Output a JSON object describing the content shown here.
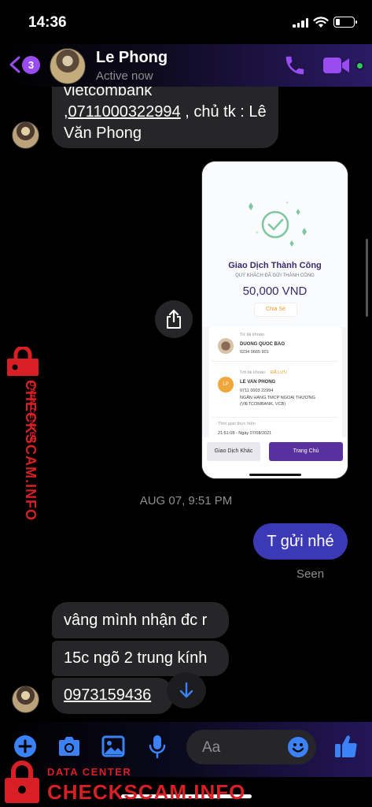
{
  "status_bar": {
    "time": "14:36",
    "battery_level": 0.25
  },
  "header": {
    "unread_count": "3",
    "contact_name": "Le Phong",
    "contact_status": "Active now",
    "icons": [
      "back-chevron-icon",
      "phone-icon",
      "video-icon"
    ],
    "accent_color": "#9a4cf1"
  },
  "messages": {
    "received_1": {
      "line1": "vietcombank",
      "account": ",0711000322994",
      "rest": " , chủ tk : Lê",
      "line3": "Văn Phong"
    },
    "screenshot": {
      "title": "Giao Dịch Thành Công",
      "subtitle": "QUÝ KHÁCH ĐÃ GỬI THÀNH CÔNG",
      "amount": "50,000 VND",
      "share_label": "Chia Sẻ",
      "from_label": "Từ tài khoản",
      "from_name": "DUONG QUOC BAO",
      "from_account": "0234 0665 901",
      "to_label": "Tới tài khoản",
      "saved_label": "ĐÃ LƯU",
      "to_initials": "LP",
      "to_name": "LE VAN PHONG",
      "to_account": "0711 0003 22994",
      "to_bank": "NGÂN HÀNG TMCP NGOẠI THƯƠNG (VIETCOMBANK, VCB)",
      "time_label": "Thời gian thực hiện",
      "time_value": "21:51:08 - Ngày 07/08/2021",
      "button_other": "Giao Dịch Khác",
      "button_home": "Trang Chủ"
    },
    "date_separator": "AUG 07, 9:51 PM",
    "sent_1": "T gửi nhé",
    "seen_label": "Seen",
    "received_2": "vâng mình nhận đc r",
    "received_3": "15c ngõ 2 trung kính",
    "received_4": "0973159436"
  },
  "composer": {
    "placeholder": "Aa",
    "icons": [
      "plus-icon",
      "camera-icon",
      "gallery-icon",
      "microphone-icon",
      "emoji-icon",
      "thumbs-up-icon"
    ]
  },
  "watermark": {
    "label": "DATA CENTER",
    "brand": "CHECKSCAM.INFO",
    "color": "#d81f26"
  }
}
